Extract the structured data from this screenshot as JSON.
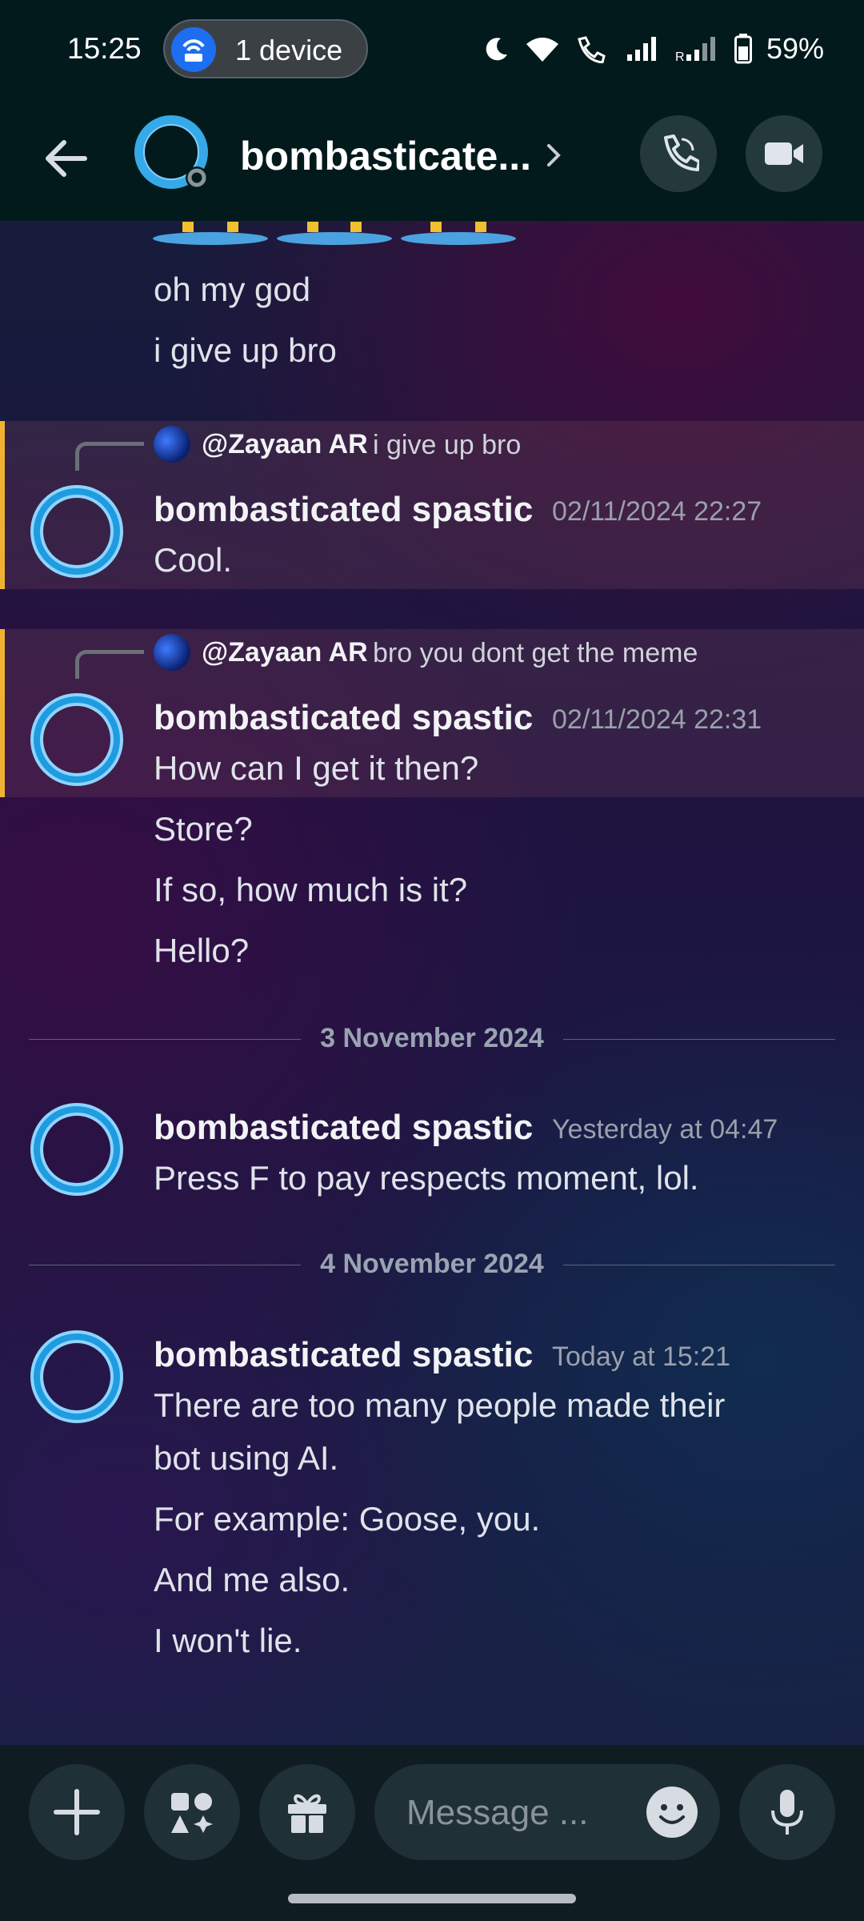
{
  "status_bar": {
    "time": "15:25",
    "hotspot_label": "1 device",
    "battery": "59%",
    "icons": [
      "moon-icon",
      "wifi-icon",
      "wifi-call-icon",
      "signal-icon",
      "signal-roaming-icon",
      "battery-icon"
    ]
  },
  "header": {
    "title": "bombasticate...",
    "back_icon": "arrow-left-icon",
    "call_icon": "phone-icon",
    "video_icon": "video-camera-icon"
  },
  "messages": {
    "top": [
      "oh my god",
      "i give up bro"
    ],
    "group1": {
      "reply_name": "@Zayaan AR",
      "reply_text": "i give up bro",
      "author": "bombasticated spastic",
      "timestamp": "02/11/2024 22:27",
      "lines": [
        "Cool."
      ]
    },
    "group2": {
      "reply_name": "@Zayaan AR",
      "reply_text": "bro you dont get the meme",
      "author": "bombasticated spastic",
      "timestamp": "02/11/2024 22:31",
      "lines": [
        "How can I get it then?",
        "Store?",
        "If so, how much is it?",
        "Hello?"
      ]
    },
    "divider1": "3 November 2024",
    "group3": {
      "author": "bombasticated spastic",
      "timestamp": "Yesterday at 04:47",
      "lines": [
        "Press F to pay respects moment, lol."
      ]
    },
    "divider2": "4 November 2024",
    "group4": {
      "author": "bombasticated spastic",
      "timestamp": "Today at 15:21",
      "lines": [
        "There are too many people made their",
        "bot using AI.",
        "For example: Goose, you.",
        "And me also.",
        "I won't lie."
      ]
    }
  },
  "composer": {
    "placeholder": "Message ...",
    "buttons": [
      "plus-icon",
      "apps-icon",
      "gift-icon",
      "emoji-icon",
      "microphone-icon"
    ]
  },
  "colors": {
    "accent_reply_bar": "#f0b232",
    "avatar_ring": "#36a9e8",
    "header_bg": "#031a1c"
  }
}
